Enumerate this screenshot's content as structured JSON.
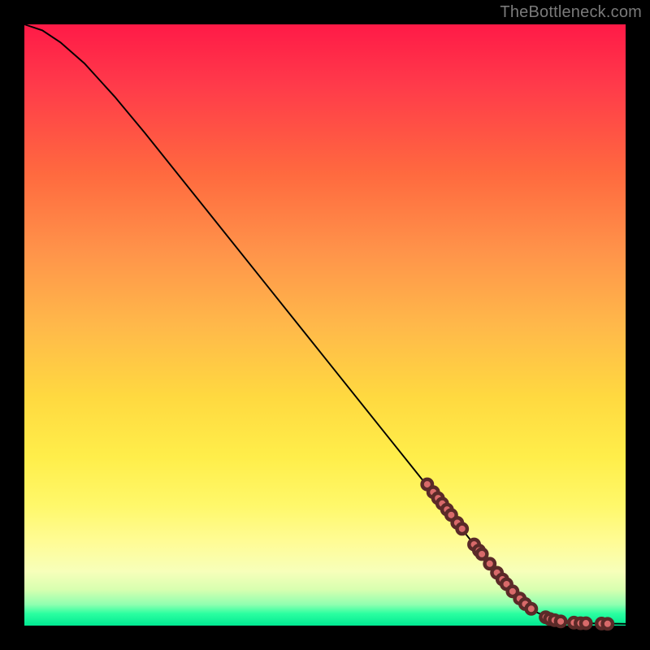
{
  "watermark": "TheBottleneck.com",
  "colors": {
    "frame_bg": "#000000",
    "dot_fill": "#d86a6a",
    "dot_stroke": "#5a2a28",
    "line": "#000000"
  },
  "chart_data": {
    "type": "line",
    "title": "",
    "xlabel": "",
    "ylabel": "",
    "xlim": [
      0,
      100
    ],
    "ylim": [
      0,
      100
    ],
    "grid": false,
    "legend": false,
    "curve": [
      {
        "x": 0,
        "y": 100
      },
      {
        "x": 3,
        "y": 99
      },
      {
        "x": 6,
        "y": 97
      },
      {
        "x": 10,
        "y": 93.5
      },
      {
        "x": 15,
        "y": 88
      },
      {
        "x": 20,
        "y": 82
      },
      {
        "x": 30,
        "y": 69.5
      },
      {
        "x": 40,
        "y": 57
      },
      {
        "x": 50,
        "y": 44.5
      },
      {
        "x": 60,
        "y": 32
      },
      {
        "x": 70,
        "y": 19.5
      },
      {
        "x": 78,
        "y": 9.5
      },
      {
        "x": 82,
        "y": 5
      },
      {
        "x": 85,
        "y": 2.3
      },
      {
        "x": 88,
        "y": 1.0
      },
      {
        "x": 92,
        "y": 0.4
      },
      {
        "x": 100,
        "y": 0.3
      }
    ],
    "points": [
      {
        "x": 67,
        "y": 23.5
      },
      {
        "x": 68,
        "y": 22.2
      },
      {
        "x": 68.8,
        "y": 21.2
      },
      {
        "x": 69.5,
        "y": 20.3
      },
      {
        "x": 70.3,
        "y": 19.3
      },
      {
        "x": 71,
        "y": 18.4
      },
      {
        "x": 72,
        "y": 17.1
      },
      {
        "x": 72.8,
        "y": 16.1
      },
      {
        "x": 74.8,
        "y": 13.5
      },
      {
        "x": 75.6,
        "y": 12.5
      },
      {
        "x": 76.1,
        "y": 11.9
      },
      {
        "x": 77.4,
        "y": 10.3
      },
      {
        "x": 78.6,
        "y": 8.8
      },
      {
        "x": 79.5,
        "y": 7.7
      },
      {
        "x": 80.2,
        "y": 6.9
      },
      {
        "x": 81.2,
        "y": 5.7
      },
      {
        "x": 82.4,
        "y": 4.5
      },
      {
        "x": 83.3,
        "y": 3.6
      },
      {
        "x": 84.3,
        "y": 2.8
      },
      {
        "x": 86.7,
        "y": 1.4
      },
      {
        "x": 87.4,
        "y": 1.1
      },
      {
        "x": 88.2,
        "y": 0.9
      },
      {
        "x": 89.2,
        "y": 0.7
      },
      {
        "x": 91.4,
        "y": 0.5
      },
      {
        "x": 92.5,
        "y": 0.4
      },
      {
        "x": 93.4,
        "y": 0.4
      },
      {
        "x": 96.0,
        "y": 0.35
      },
      {
        "x": 97.0,
        "y": 0.3
      }
    ],
    "dot_radius_px": 6.2
  }
}
